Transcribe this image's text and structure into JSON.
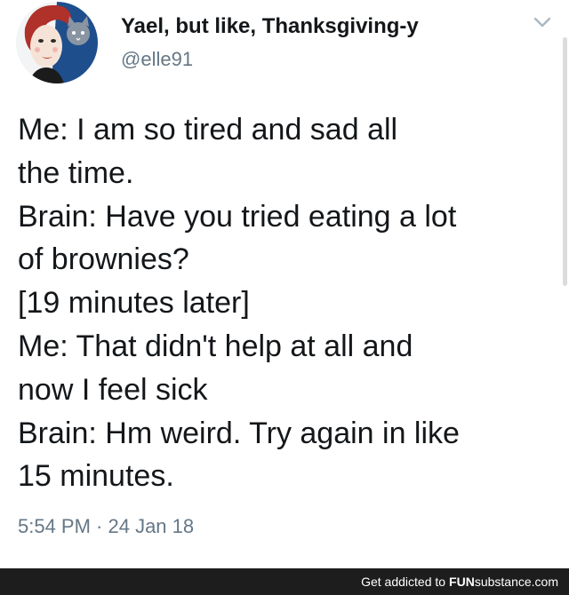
{
  "tweet": {
    "display_name": "Yael, but like, Thanksgiving-y",
    "handle": "@elle91",
    "lines": [
      "Me: I am so tired and sad all",
      "the time.",
      "Brain: Have you tried eating a lot",
      "of brownies?",
      "[19 minutes later]",
      "Me: That didn't help at all and",
      "now I feel sick",
      "Brain: Hm weird. Try again in like",
      "15 minutes."
    ],
    "timestamp": "5:54 PM · 24 Jan 18",
    "avatar_icon": "woman-with-cat-avatar-icon",
    "menu_icon": "chevron-down-icon"
  },
  "footer": {
    "text": "Get addicted to",
    "brand_bold": "FUN",
    "brand_rest": "substance.com"
  },
  "colors": {
    "text": "#14171a",
    "muted": "#657786",
    "footer_bg": "#1d1d1d",
    "avatar_hair": "#c0392b",
    "avatar_bg": "#1e4e8c"
  }
}
